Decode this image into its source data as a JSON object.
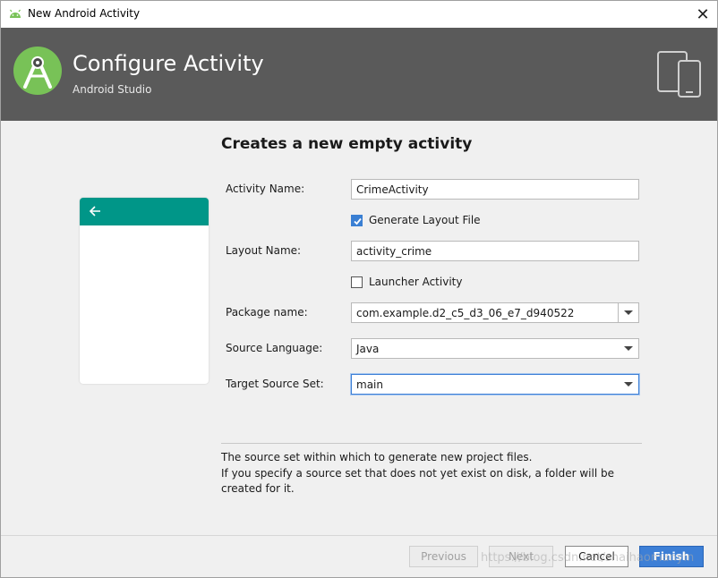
{
  "window": {
    "title": "New Android Activity",
    "close_glyph": "✕"
  },
  "header": {
    "title": "Configure Activity",
    "subtitle": "Android Studio"
  },
  "preview": {
    "toolbar_color": "#009688"
  },
  "form": {
    "heading": "Creates a new empty activity",
    "activity_name": {
      "label": "Activity Name:",
      "value": "CrimeActivity"
    },
    "generate_layout": {
      "label": "Generate Layout File",
      "checked": true
    },
    "layout_name": {
      "label": "Layout Name:",
      "value": "activity_crime"
    },
    "launcher_activity": {
      "label": "Launcher Activity",
      "checked": false
    },
    "package_name": {
      "label": "Package name:",
      "value": "com.example.d2_c5_d3_06_e7_d940522"
    },
    "source_language": {
      "label": "Source Language:",
      "value": "Java"
    },
    "target_source_set": {
      "label": "Target Source Set:",
      "value": "main"
    }
  },
  "help": {
    "line1": "The source set within which to generate new project files.",
    "line2": "If you specify a source set that does not yet exist on disk, a folder will be created for it."
  },
  "footer": {
    "previous": "Previous",
    "next": "Next",
    "cancel": "Cancel",
    "finish": "Finish"
  },
  "watermark": "https://blog.csdn.net/shaihaomanyin",
  "colors": {
    "header_bg": "#5a5a5a",
    "accent": "#3d7fd6",
    "android_green": "#78c257"
  }
}
